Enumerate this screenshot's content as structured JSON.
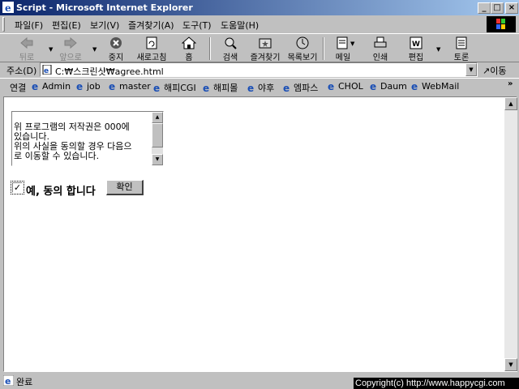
{
  "window": {
    "title": "Script - Microsoft Internet Explorer"
  },
  "menu": [
    "파일(F)",
    "편집(E)",
    "보기(V)",
    "즐겨찾기(A)",
    "도구(T)",
    "도움말(H)"
  ],
  "toolbar": {
    "back": "뒤로",
    "forward": "앞으로",
    "stop": "중지",
    "refresh": "새로고침",
    "home": "홈",
    "search": "검색",
    "favorites": "즐겨찾기",
    "history": "목록보기",
    "mail": "메일",
    "print": "인쇄",
    "edit": "편집",
    "discuss": "토론"
  },
  "address": {
    "label": "주소(D)",
    "value": "C:₩스크린샷₩agree.html",
    "go": "이동"
  },
  "links": {
    "label": "연결",
    "items": [
      "Admin",
      "job",
      "master",
      "해피CGI",
      "해피몰",
      "야후",
      "엠파스",
      "CHOL",
      "Daum",
      "WebMail"
    ]
  },
  "page": {
    "agreement_text": "위 프로그램의 저작권은 000에\n있습니다.\n위의 사실을 동의할 경우 다음으\n로 이동할 수 있습니다.",
    "agree_label": "예, 동의 합니다",
    "agree_checked": true,
    "confirm_button": "확인"
  },
  "status": {
    "text": "완료"
  },
  "watermark": {
    "text": "Copyright(c) http://www.happycgi.com"
  }
}
